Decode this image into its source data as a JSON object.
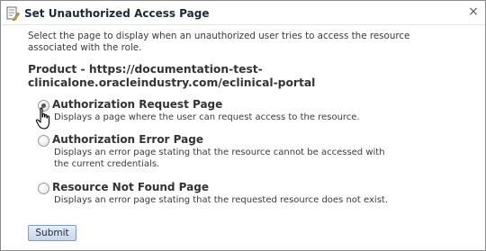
{
  "dialog": {
    "title": "Set Unauthorized Access Page",
    "close_symbol": "×",
    "icon": "page-edit-icon"
  },
  "instructions": "Select the page to display when an unauthorized user tries to access the resource associated with the role.",
  "product": "Product - https://documentation-test-clinicalone.oracleindustry.com/eclinical-portal",
  "options": [
    {
      "label": "Authorization Request Page",
      "description": "Displays a page where the user can request access to the resource.",
      "selected": true
    },
    {
      "label": "Authorization Error Page",
      "description": "Displays an error page stating that the resource cannot be accessed with the current credentials.",
      "selected": false
    },
    {
      "label": "Resource Not Found Page",
      "description": "Displays an error page stating that the requested resource does not exist.",
      "selected": false
    }
  ],
  "submit_label": "Submit",
  "colors": {
    "button_border": "#7f9dc2",
    "title_text": "#1e2a38"
  }
}
